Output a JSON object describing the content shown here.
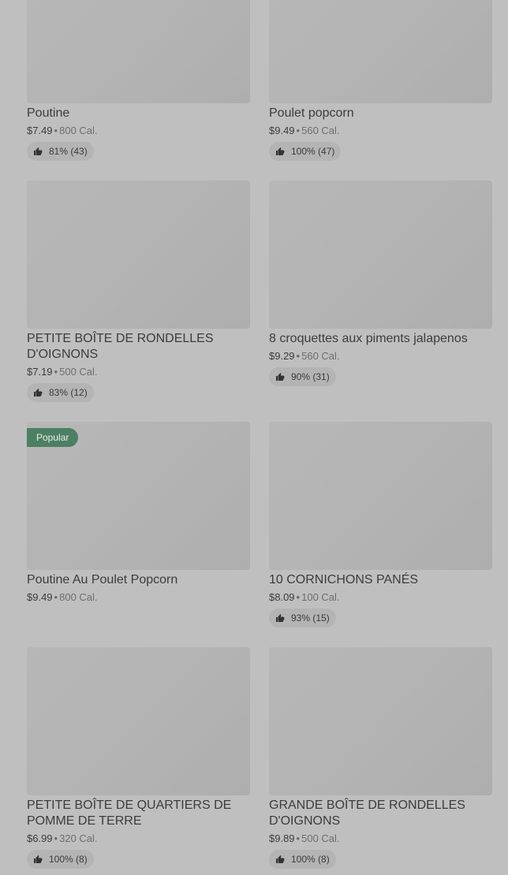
{
  "items": [
    {
      "name": "Poutine",
      "price": "$7.49",
      "cal": "800 Cal.",
      "rating": "81% (43)"
    },
    {
      "name": "Poulet popcorn",
      "price": "$9.49",
      "cal": "560 Cal.",
      "rating": "100% (47)"
    },
    {
      "name": "PETITE BOÎTE DE RONDELLES D'OIGNONS",
      "price": "$7.19",
      "cal": "500 Cal.",
      "rating": "83% (12)"
    },
    {
      "name": "8 croquettes aux piments jalapenos",
      "price": "$9.29",
      "cal": "560 Cal.",
      "rating": "90% (31)"
    },
    {
      "name": "Poutine Au Poulet Popcorn",
      "price": "$9.49",
      "cal": "800 Cal.",
      "rating": "",
      "badge": "Popular"
    },
    {
      "name": "10 CORNICHONS PANÉS",
      "price": "$8.09",
      "cal": "100 Cal.",
      "rating": "93% (15)"
    },
    {
      "name": "PETITE BOÎTE DE QUARTIERS DE POMME DE TERRE",
      "price": "$6.99",
      "cal": "320 Cal.",
      "rating": "100% (8)"
    },
    {
      "name": "GRANDE BOÎTE DE RONDELLES D'OIGNONS",
      "price": "$9.89",
      "cal": "500 Cal.",
      "rating": "100% (8)"
    }
  ],
  "separator": "•",
  "icons": {
    "rating": "thumbs-up-icon"
  },
  "colors": {
    "badge": "#4d7f63",
    "background": "#bfbfbf"
  }
}
